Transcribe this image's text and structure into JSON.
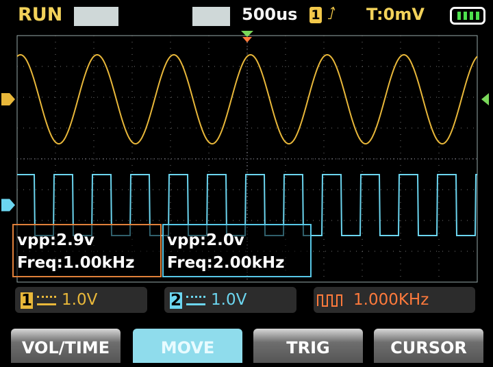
{
  "status": {
    "run_state": "RUN",
    "timebase": "500us",
    "trigger_channel": "1",
    "trigger_edge_icon": "rising-edge-icon",
    "trigger_level": "T:0mV",
    "battery_icon": "battery-icon"
  },
  "channels": [
    {
      "id": "1",
      "color": "#e9b83a",
      "coupling_icon": "dc-coupling-icon",
      "scale": "1.0V",
      "vpp": "vpp:2.9v",
      "freq": "Freq:1.00kHz",
      "waveform": "sine",
      "frequency_hz": 1000
    },
    {
      "id": "2",
      "color": "#6cd6f0",
      "coupling_icon": "dc-coupling-icon",
      "scale": "1.0V",
      "vpp": "vpp:2.0v",
      "freq": "Freq:2.00kHz",
      "waveform": "square",
      "frequency_hz": 2000
    }
  ],
  "generator": {
    "icon": "square-wave-icon",
    "frequency": "1.000KHz",
    "color": "#ff7a3c"
  },
  "buttons": [
    {
      "label": "VOL/TIME",
      "active": false
    },
    {
      "label": "MOVE",
      "active": true
    },
    {
      "label": "TRIG",
      "active": false
    },
    {
      "label": "CURSOR",
      "active": false
    }
  ]
}
